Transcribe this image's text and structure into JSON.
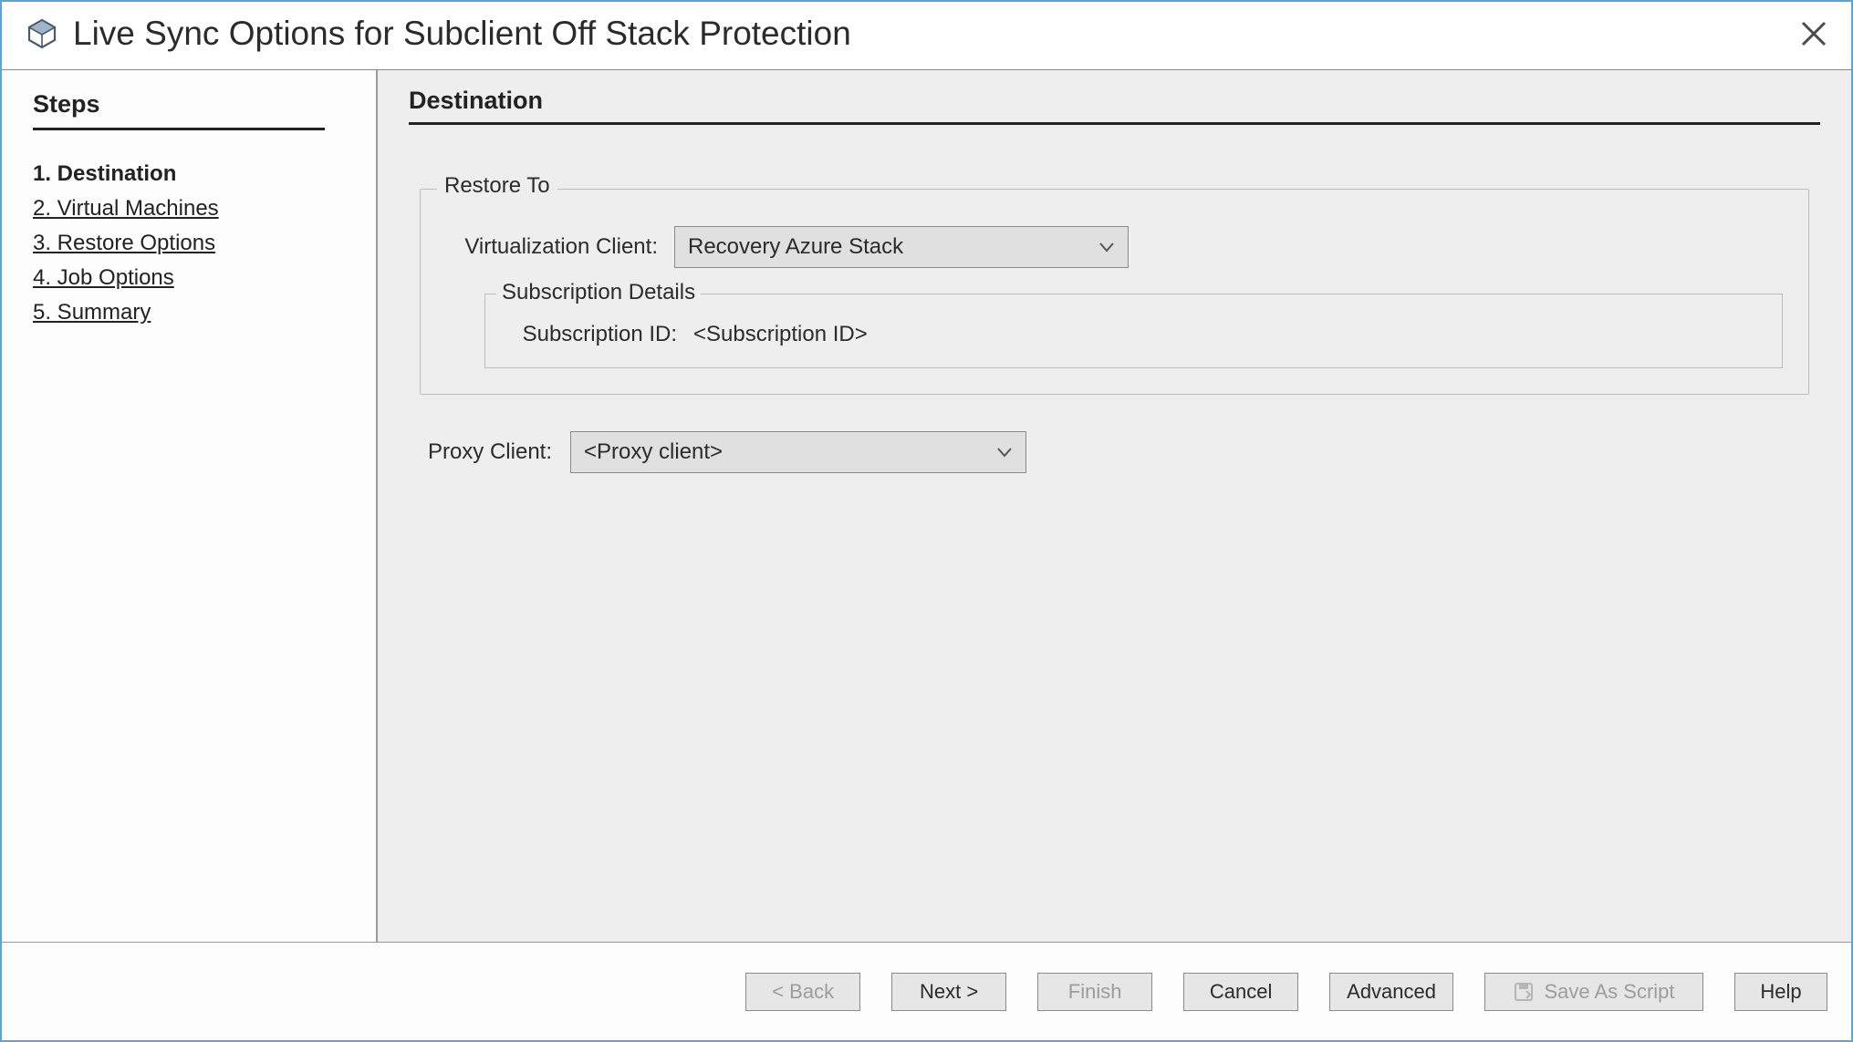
{
  "header": {
    "title": "Live Sync Options for Subclient Off Stack Protection"
  },
  "sidebar": {
    "heading": "Steps",
    "items": [
      {
        "label": "1. Destination",
        "current": true
      },
      {
        "label": "2. Virtual Machines",
        "current": false
      },
      {
        "label": "3. Restore Options",
        "current": false
      },
      {
        "label": "4. Job Options",
        "current": false
      },
      {
        "label": "5. Summary",
        "current": false
      }
    ]
  },
  "main": {
    "heading": "Destination",
    "restore_to": {
      "legend": "Restore To",
      "virt_client_label": "Virtualization Client:",
      "virt_client_value": "Recovery Azure Stack",
      "subscription_legend": "Subscription Details",
      "subscription_id_label": "Subscription ID:",
      "subscription_id_value": "<Subscription ID>"
    },
    "proxy": {
      "label": "Proxy Client:",
      "value": "<Proxy client>"
    }
  },
  "footer": {
    "back": "< Back",
    "next": "Next >",
    "finish": "Finish",
    "cancel": "Cancel",
    "advanced": "Advanced",
    "save_script": "Save As Script",
    "help": "Help"
  }
}
